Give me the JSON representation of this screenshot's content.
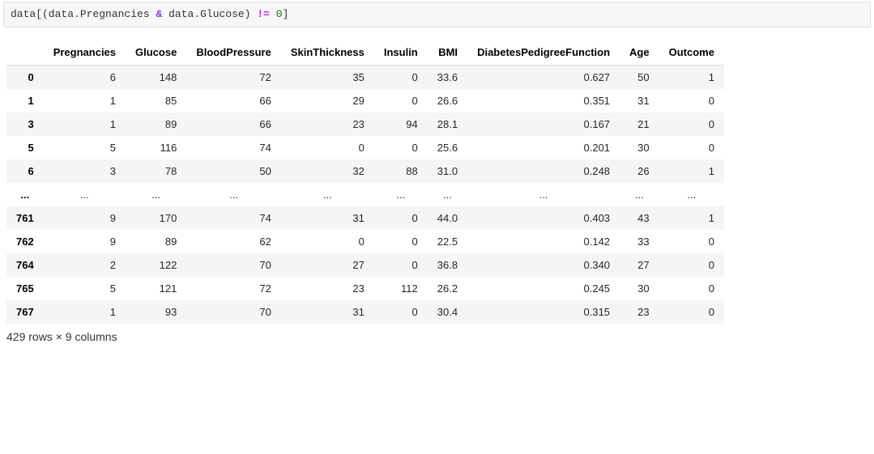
{
  "code": {
    "t1": "data[(data",
    "dot1": ".",
    "attr1": "Pregnancies",
    "space1": " ",
    "op1": "&",
    "space2": " ",
    "t2": "data",
    "dot2": ".",
    "attr2": "Glucose",
    "t3": ") ",
    "op2": "!=",
    "space3": " ",
    "num": "0",
    "t4": "]"
  },
  "columns": [
    "Pregnancies",
    "Glucose",
    "BloodPressure",
    "SkinThickness",
    "Insulin",
    "BMI",
    "DiabetesPedigreeFunction",
    "Age",
    "Outcome"
  ],
  "rows": [
    {
      "idx": "0",
      "cells": [
        "6",
        "148",
        "72",
        "35",
        "0",
        "33.6",
        "0.627",
        "50",
        "1"
      ]
    },
    {
      "idx": "1",
      "cells": [
        "1",
        "85",
        "66",
        "29",
        "0",
        "26.6",
        "0.351",
        "31",
        "0"
      ]
    },
    {
      "idx": "3",
      "cells": [
        "1",
        "89",
        "66",
        "23",
        "94",
        "28.1",
        "0.167",
        "21",
        "0"
      ]
    },
    {
      "idx": "5",
      "cells": [
        "5",
        "116",
        "74",
        "0",
        "0",
        "25.6",
        "0.201",
        "30",
        "0"
      ]
    },
    {
      "idx": "6",
      "cells": [
        "3",
        "78",
        "50",
        "32",
        "88",
        "31.0",
        "0.248",
        "26",
        "1"
      ]
    },
    {
      "idx": "...",
      "cells": [
        "...",
        "...",
        "...",
        "...",
        "...",
        "...",
        "...",
        "...",
        "..."
      ],
      "ellipsis": true
    },
    {
      "idx": "761",
      "cells": [
        "9",
        "170",
        "74",
        "31",
        "0",
        "44.0",
        "0.403",
        "43",
        "1"
      ]
    },
    {
      "idx": "762",
      "cells": [
        "9",
        "89",
        "62",
        "0",
        "0",
        "22.5",
        "0.142",
        "33",
        "0"
      ]
    },
    {
      "idx": "764",
      "cells": [
        "2",
        "122",
        "70",
        "27",
        "0",
        "36.8",
        "0.340",
        "27",
        "0"
      ]
    },
    {
      "idx": "765",
      "cells": [
        "5",
        "121",
        "72",
        "23",
        "112",
        "26.2",
        "0.245",
        "30",
        "0"
      ]
    },
    {
      "idx": "767",
      "cells": [
        "1",
        "93",
        "70",
        "31",
        "0",
        "30.4",
        "0.315",
        "23",
        "0"
      ]
    }
  ],
  "shape_text": "429 rows × 9 columns"
}
